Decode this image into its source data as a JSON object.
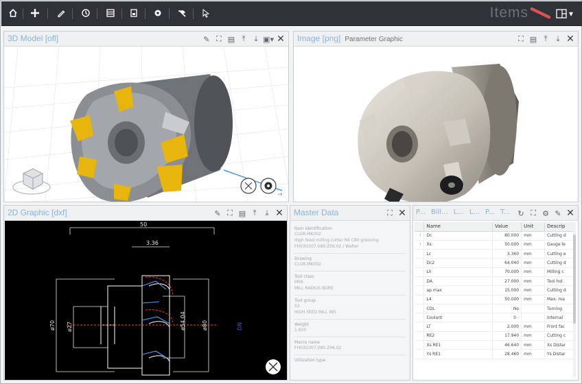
{
  "toolbar": {
    "app_title": "Items",
    "accent_color": "#d9534f",
    "icons": [
      "home-icon",
      "add-icon",
      "edit-icon",
      "history-icon",
      "database-icon",
      "save-icon",
      "settings-icon",
      "hammer-icon",
      "pointer-icon"
    ]
  },
  "panel_3d": {
    "title": "3D Model [ofl]"
  },
  "panel_image": {
    "title": "Image [png]",
    "subtitle": "Parameter Graphic"
  },
  "panel_2d": {
    "title": "2D Graphic [dxf]",
    "dims": {
      "d50": "50",
      "d336": "3.36",
      "d70": "ø70",
      "d27": "ø27",
      "d5404": "ø54.04",
      "d80": "ø80",
      "side": "DN"
    }
  },
  "panel_master": {
    "title": "Master Data",
    "fields": [
      {
        "label": "Item identification",
        "value": "CLGR-MK002"
      },
      {
        "label": "",
        "value": "High feed milling cutter R6 C80 grooving"
      },
      {
        "label": "",
        "value": "FH03O307.080.Z06.02 / Walter"
      },
      {
        "label": "Drawing",
        "value": "CLGR-MK002"
      },
      {
        "label": "Tool class",
        "value": "M06"
      },
      {
        "label": "",
        "value": "MILL RADIUS BORE"
      },
      {
        "label": "Tool group",
        "value": "52"
      },
      {
        "label": "",
        "value": "HIGH FEED MILL INS"
      },
      {
        "label": "Weight",
        "value": "1.930"
      },
      {
        "label": "Macro name",
        "value": "FH03O307.080.Z06.02"
      },
      {
        "label": "Utilization type",
        "value": ""
      }
    ]
  },
  "panel_params": {
    "tabs": [
      "P...",
      "Bill...",
      "L...",
      "L...",
      "P...",
      "T..."
    ],
    "columns": [
      "Name",
      "Value",
      "Unit",
      "Descrip"
    ],
    "rows": [
      {
        "flag": "!",
        "name": "Dc",
        "value": "80.000",
        "unit": "mm",
        "desc": "Cutting d"
      },
      {
        "flag": "!",
        "name": "Xs",
        "value": "50.000",
        "unit": "mm",
        "desc": "Gauge le"
      },
      {
        "flag": "",
        "name": "Lc",
        "value": "3.360",
        "unit": "mm",
        "desc": "Cutting e"
      },
      {
        "flag": "",
        "name": "Dc2",
        "value": "64.040",
        "unit": "mm",
        "desc": "Cutting d"
      },
      {
        "flag": "",
        "name": "Lh",
        "value": "70.000",
        "unit": "mm",
        "desc": "Milling c"
      },
      {
        "flag": "",
        "name": "DA",
        "value": "27.000",
        "unit": "mm",
        "desc": "Tool hol"
      },
      {
        "flag": "",
        "name": "ap max",
        "value": "15.000",
        "unit": "mm",
        "desc": "Cutting d"
      },
      {
        "flag": "",
        "name": "L4",
        "value": "50.000",
        "unit": "mm",
        "desc": "Max. ma"
      },
      {
        "flag": "",
        "name": "CDL",
        "value": "No",
        "unit": "",
        "desc": "Turning"
      },
      {
        "flag": "",
        "name": "Coolant",
        "value": "0 -",
        "unit": "",
        "desc": "Internal"
      },
      {
        "flag": "",
        "name": "LT",
        "value": "2.000",
        "unit": "mm",
        "desc": "Front fac"
      },
      {
        "flag": "",
        "name": "RE2",
        "value": "17.940",
        "unit": "mm",
        "desc": "Cutting c"
      },
      {
        "flag": "",
        "name": "Xs RE1",
        "value": "46.640",
        "unit": "mm",
        "desc": "Xs Distar"
      },
      {
        "flag": "",
        "name": "Ys RE1",
        "value": "28.460",
        "unit": "mm",
        "desc": "Ys Distar"
      }
    ]
  }
}
